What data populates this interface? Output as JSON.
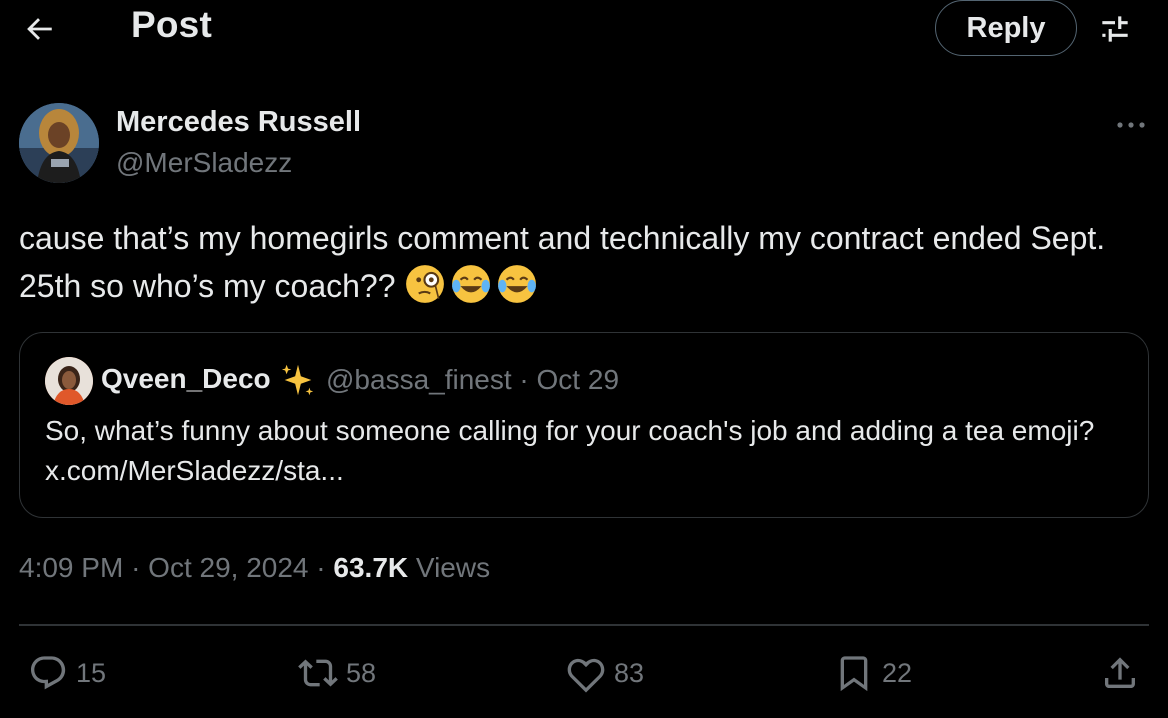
{
  "header": {
    "title": "Post",
    "reply_label": "Reply",
    "back_icon": "arrow-left-icon",
    "settings_icon": "sliders-icon"
  },
  "author": {
    "name": "Mercedes Russell",
    "handle": "@MerSladezz"
  },
  "post": {
    "text": "cause that’s my homegirls comment and technically my contract ended Sept. 25th so who’s my coach??",
    "emojis": [
      "face-with-monocle",
      "face-with-tears-of-joy",
      "face-with-tears-of-joy"
    ]
  },
  "quote": {
    "name": "Qveen_Deco",
    "handle": "@bassa_finest",
    "separator": "·",
    "date": "Oct 29",
    "text": "So, what’s funny about someone calling for your coach's job and adding a tea emoji? x.com/MerSladezz/sta..."
  },
  "meta": {
    "time": "4:09 PM",
    "separator": "·",
    "date": "Oct 29, 2024",
    "views_count": "63.7K",
    "views_label": "Views"
  },
  "actions": {
    "replies": "15",
    "reposts": "58",
    "likes": "83",
    "bookmarks": "22"
  },
  "colors": {
    "background": "#000000",
    "text": "#e7e9ea",
    "secondary": "#71767b",
    "border": "#2f3336"
  }
}
